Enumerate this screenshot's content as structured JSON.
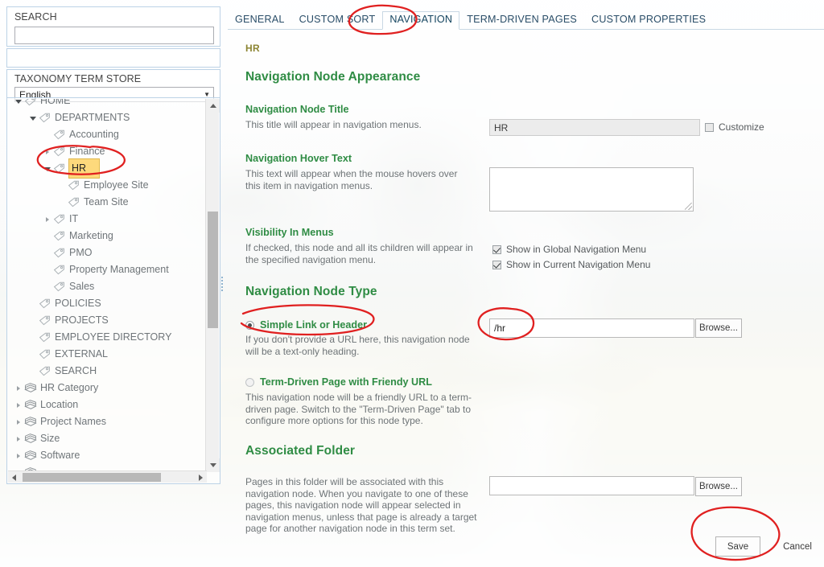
{
  "colors": {
    "green_heading": "#2f8c44",
    "tab_text": "#2a4d68",
    "crumb": "#8c8533",
    "annotation_red": "#e02020",
    "selected_term_highlight": "#fdd97c"
  },
  "left_panel": {
    "search_label": "SEARCH",
    "search_value": "",
    "search_placeholder": "",
    "term_store_label": "TAXONOMY TERM STORE",
    "language_selected": "English",
    "language_caret": "chevron-down-icon",
    "tree": [
      {
        "label": "HOME",
        "depth": 1,
        "twisty": "open",
        "icon": "term-tag-icon",
        "selected": false,
        "clipped": true
      },
      {
        "label": "DEPARTMENTS",
        "depth": 2,
        "twisty": "open",
        "icon": "term-tag-icon",
        "selected": false
      },
      {
        "label": "Accounting",
        "depth": 3,
        "twisty": "none",
        "icon": "term-tag-icon",
        "selected": false
      },
      {
        "label": "Finance",
        "depth": 3,
        "twisty": "closed",
        "icon": "term-tag-icon",
        "selected": false
      },
      {
        "label": "HR",
        "depth": 3,
        "twisty": "open",
        "icon": "term-tag-icon",
        "selected": true
      },
      {
        "label": "Employee Site",
        "depth": 4,
        "twisty": "none",
        "icon": "term-tag-icon",
        "selected": false
      },
      {
        "label": "Team Site",
        "depth": 4,
        "twisty": "none",
        "icon": "term-tag-icon",
        "selected": false
      },
      {
        "label": "IT",
        "depth": 3,
        "twisty": "closed",
        "icon": "term-tag-icon",
        "selected": false
      },
      {
        "label": "Marketing",
        "depth": 3,
        "twisty": "none",
        "icon": "term-tag-icon",
        "selected": false
      },
      {
        "label": "PMO",
        "depth": 3,
        "twisty": "none",
        "icon": "term-tag-icon",
        "selected": false
      },
      {
        "label": "Property Management",
        "depth": 3,
        "twisty": "none",
        "icon": "term-tag-icon",
        "selected": false
      },
      {
        "label": "Sales",
        "depth": 3,
        "twisty": "none",
        "icon": "term-tag-icon",
        "selected": false
      },
      {
        "label": "POLICIES",
        "depth": 2,
        "twisty": "none",
        "icon": "term-tag-icon",
        "selected": false
      },
      {
        "label": "PROJECTS",
        "depth": 2,
        "twisty": "none",
        "icon": "term-tag-icon",
        "selected": false
      },
      {
        "label": "EMPLOYEE DIRECTORY",
        "depth": 2,
        "twisty": "none",
        "icon": "term-tag-icon",
        "selected": false
      },
      {
        "label": "EXTERNAL",
        "depth": 2,
        "twisty": "none",
        "icon": "term-tag-icon",
        "selected": false
      },
      {
        "label": "SEARCH",
        "depth": 2,
        "twisty": "none",
        "icon": "term-tag-icon",
        "selected": false
      },
      {
        "label": "HR Category",
        "depth": 1,
        "twisty": "closed",
        "icon": "term-set-icon",
        "selected": false
      },
      {
        "label": "Location",
        "depth": 1,
        "twisty": "closed",
        "icon": "term-set-icon",
        "selected": false
      },
      {
        "label": "Project Names",
        "depth": 1,
        "twisty": "closed",
        "icon": "term-set-icon",
        "selected": false
      },
      {
        "label": "Size",
        "depth": 1,
        "twisty": "closed",
        "icon": "term-set-icon",
        "selected": false
      },
      {
        "label": "Software",
        "depth": 1,
        "twisty": "closed",
        "icon": "term-set-icon",
        "selected": false
      },
      {
        "label": "",
        "depth": 1,
        "twisty": "none",
        "icon": "term-set-icon",
        "selected": false,
        "clipped": true
      }
    ]
  },
  "tabs": [
    {
      "label": "GENERAL",
      "active": false
    },
    {
      "label": "CUSTOM SORT",
      "active": false
    },
    {
      "label": "NAVIGATION",
      "active": true
    },
    {
      "label": "TERM-DRIVEN PAGES",
      "active": false
    },
    {
      "label": "CUSTOM PROPERTIES",
      "active": false
    }
  ],
  "breadcrumb": "HR",
  "sections": {
    "appearance": {
      "heading": "Navigation Node Appearance",
      "node_title": {
        "label": "Navigation Node Title",
        "description": "This title will appear in navigation menus.",
        "value": "HR",
        "placeholder": "",
        "customize_label": "Customize",
        "customize_checked": false
      },
      "hover_text": {
        "label": "Navigation Hover Text",
        "description": "This text will appear when the mouse hovers over this item in navigation menus.",
        "value": "",
        "placeholder": ""
      },
      "visibility": {
        "label": "Visibility In Menus",
        "description": "If checked, this node and all its children will appear in the specified navigation menu.",
        "options": [
          {
            "label": "Show in Global Navigation Menu",
            "checked": true
          },
          {
            "label": "Show in Current Navigation Menu",
            "checked": true
          }
        ]
      }
    },
    "node_type": {
      "heading": "Navigation Node Type",
      "options": [
        {
          "label": "Simple Link or Header",
          "selected": true,
          "description": "If you don't provide a URL here, this navigation node will be a text-only heading.",
          "url_value": "/hr",
          "url_placeholder": "",
          "browse_label": "Browse..."
        },
        {
          "label": "Term-Driven Page with Friendy URL",
          "selected": false,
          "description": "This navigation node will be a friendly URL to a term-driven page. Switch to the \"Term-Driven Page\" tab to configure more options for this node type."
        }
      ]
    },
    "associated_folder": {
      "heading": "Associated Folder",
      "description": "Pages in this folder will be associated with this navigation node. When you navigate to one of these pages, this navigation node will appear selected in navigation menus, unless that page is already a target page for another navigation node in this term set.",
      "value": "",
      "placeholder": "",
      "browse_label": "Browse..."
    }
  },
  "footer": {
    "save_label": "Save",
    "cancel_label": "Cancel"
  },
  "annotations": [
    {
      "name": "navigation-tab-circle",
      "shape": "ellipse-hand-drawn"
    },
    {
      "name": "hr-term-circle",
      "shape": "ellipse-hand-drawn"
    },
    {
      "name": "simple-link-radio-circle",
      "shape": "ellipse-hand-drawn"
    },
    {
      "name": "url-field-circle",
      "shape": "ellipse-hand-drawn"
    },
    {
      "name": "save-button-circle",
      "shape": "ellipse-hand-drawn"
    }
  ]
}
